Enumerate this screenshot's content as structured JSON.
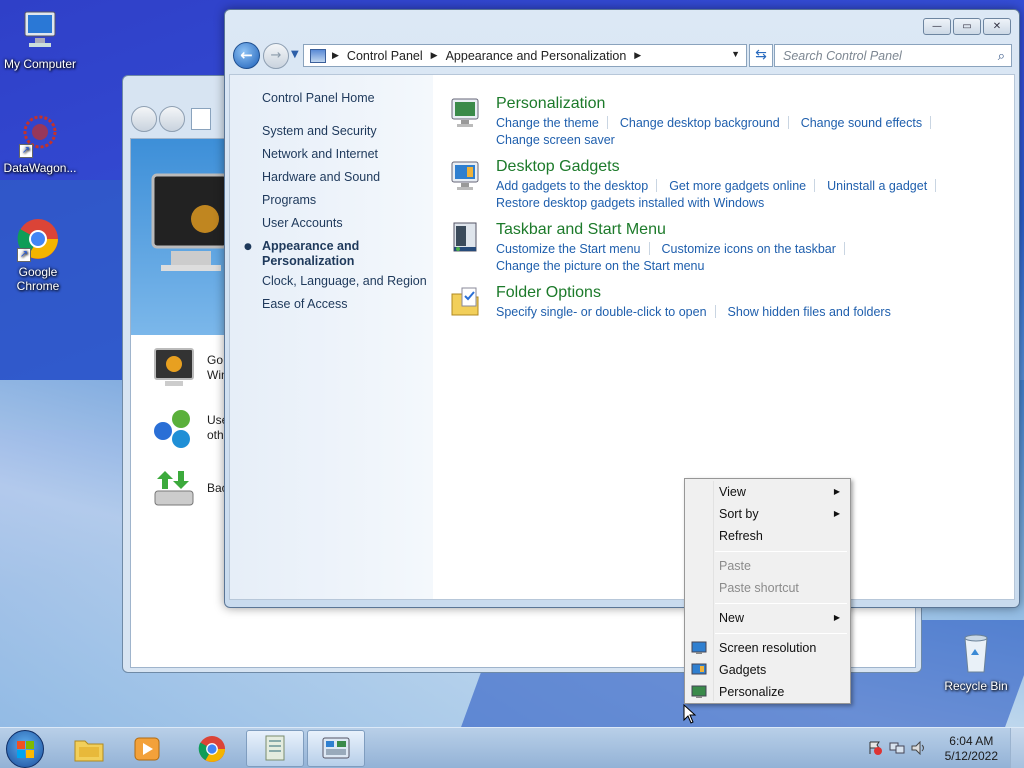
{
  "desktop": {
    "icons": [
      {
        "label": "My Computer",
        "icon": "computer-icon"
      },
      {
        "label": "DataWagon...",
        "icon": "datawagon-icon"
      },
      {
        "label": "Google Chrome",
        "icon": "chrome-icon"
      },
      {
        "label": "Recycle Bin",
        "icon": "recycle-bin-icon"
      }
    ]
  },
  "back_window": {
    "rows": [
      {
        "text": "Go o\nWind"
      },
      {
        "text": "Use\nothe"
      },
      {
        "text": "Back"
      }
    ]
  },
  "window": {
    "controls": {
      "minimize": "—",
      "maximize": "▭",
      "close": "✕"
    },
    "address": {
      "crumbs": [
        "Control Panel",
        "Appearance and Personalization"
      ]
    },
    "search": {
      "placeholder": "Search Control Panel"
    },
    "left_nav": {
      "home": "Control Panel Home",
      "items": [
        "System and Security",
        "Network and Internet",
        "Hardware and Sound",
        "Programs",
        "User Accounts",
        "Appearance and\nPersonalization",
        "Clock, Language, and Region",
        "Ease of Access"
      ],
      "selected_index": 5
    },
    "sections": [
      {
        "title": "Personalization",
        "icon": "personalization-icon",
        "links": [
          "Change the theme",
          "Change desktop background",
          "Change sound effects",
          "Change screen saver"
        ]
      },
      {
        "title": "Desktop Gadgets",
        "icon": "gadgets-icon",
        "links": [
          "Add gadgets to the desktop",
          "Get more gadgets online",
          "Uninstall a gadget",
          "Restore desktop gadgets installed with Windows"
        ]
      },
      {
        "title": "Taskbar and Start Menu",
        "icon": "taskbar-icon",
        "links": [
          "Customize the Start menu",
          "Customize icons on the taskbar",
          "Change the picture on the Start menu"
        ]
      },
      {
        "title": "Folder Options",
        "icon": "folder-options-icon",
        "links": [
          "Specify single- or double-click to open",
          "Show hidden files and folders"
        ]
      }
    ]
  },
  "context_menu": {
    "view": "View",
    "sort_by": "Sort by",
    "refresh": "Refresh",
    "paste": "Paste",
    "paste_shortcut": "Paste shortcut",
    "new": "New",
    "screen_resolution": "Screen resolution",
    "gadgets": "Gadgets",
    "personalize": "Personalize"
  },
  "taskbar": {
    "clock_time": "6:04 AM",
    "clock_date": "5/12/2022",
    "pinned": [
      "explorer-icon",
      "media-player-icon",
      "chrome-icon",
      "documents-icon",
      "control-panel-icon"
    ]
  }
}
